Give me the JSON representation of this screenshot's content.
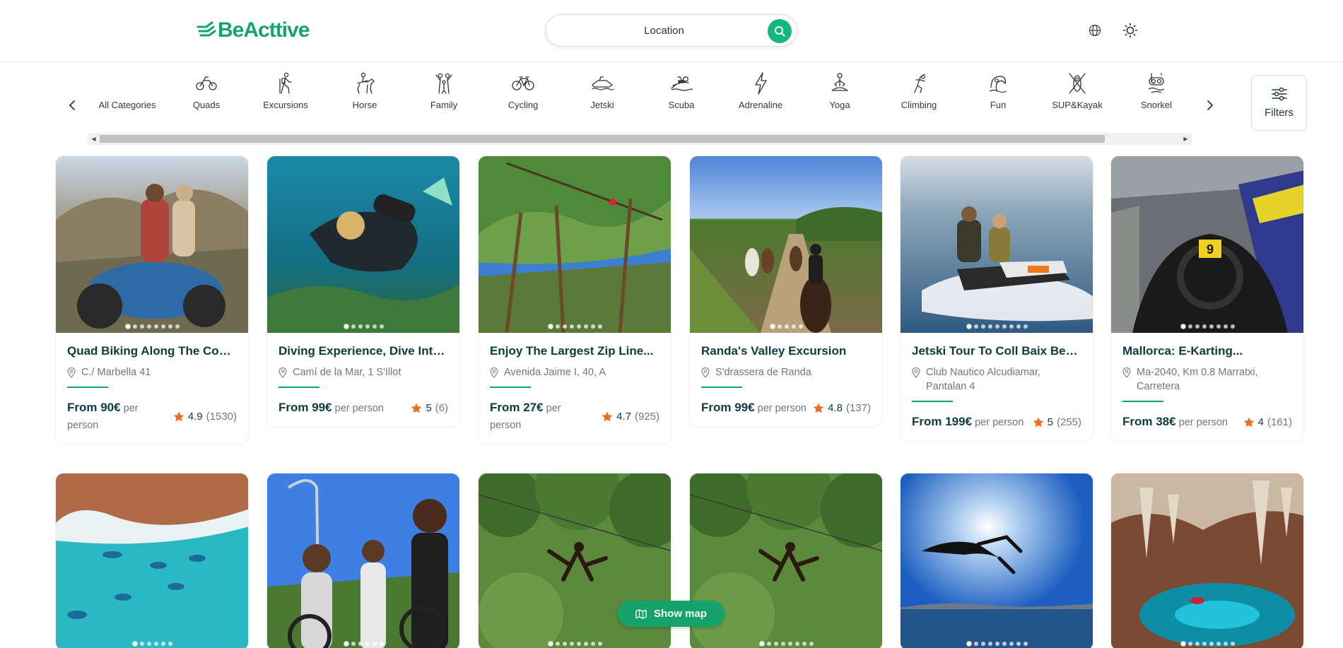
{
  "header": {
    "logo": "BeActtive",
    "search_label": "Location"
  },
  "categories": {
    "items": [
      {
        "label": "All Categories",
        "icon": "all-categories-icon"
      },
      {
        "label": "Quads",
        "icon": "quad-icon"
      },
      {
        "label": "Excursions",
        "icon": "hiker-icon"
      },
      {
        "label": "Horse",
        "icon": "horse-icon"
      },
      {
        "label": "Family",
        "icon": "family-icon"
      },
      {
        "label": "Cycling",
        "icon": "bicycle-icon"
      },
      {
        "label": "Jetski",
        "icon": "jetski-icon"
      },
      {
        "label": "Scuba",
        "icon": "scuba-icon"
      },
      {
        "label": "Adrenaline",
        "icon": "lightning-icon"
      },
      {
        "label": "Yoga",
        "icon": "yoga-icon"
      },
      {
        "label": "Climbing",
        "icon": "climbing-icon"
      },
      {
        "label": "Fun",
        "icon": "fun-icon"
      },
      {
        "label": "SUP&Kayak",
        "icon": "kayak-icon"
      },
      {
        "label": "Snorkel",
        "icon": "snorkel-icon"
      }
    ],
    "filters_label": "Filters"
  },
  "cards": [
    {
      "title": "Quad Biking Along The Coas...",
      "location": "C./ Marbella 41",
      "price": "From 90€",
      "per": "per person",
      "rating": "4.9",
      "count": "(1530)",
      "dots": 8,
      "active_dot": 1
    },
    {
      "title": "Diving Experience, Dive Into...",
      "location": "Camí de la Mar, 1 S'Illot",
      "price": "From 99€",
      "per": "per person",
      "rating": "5",
      "count": "(6)",
      "dots": 6,
      "active_dot": 1
    },
    {
      "title": "Enjoy The Largest Zip Line...",
      "location": "Avenida Jaime I, 40, A",
      "price": "From 27€",
      "per": "per person",
      "rating": "4.7",
      "count": "(925)",
      "dots": 8,
      "active_dot": 1
    },
    {
      "title": "Randa's Valley Excursion",
      "location": "S'drassera de Randa",
      "price": "From 99€",
      "per": "per person",
      "rating": "4.8",
      "count": "(137)",
      "dots": 5,
      "active_dot": 1
    },
    {
      "title": "Jetski Tour To Coll Baix Beach",
      "location": "Club Nautico Alcudiamar, Pantalan 4",
      "price": "From 199€",
      "per": "per person",
      "rating": "5",
      "count": "(255)",
      "dots": 9,
      "active_dot": 1
    },
    {
      "title": "Mallorca: E-Karting...",
      "location": "Ma-2040, Km 0.8 Marratxi, Carretera",
      "price": "From 38€",
      "per": "per person",
      "rating": "4",
      "count": "(161)",
      "dots": 8,
      "active_dot": 1
    },
    {
      "dots": 6,
      "active_dot": 1
    },
    {
      "dots": 6,
      "active_dot": 1
    },
    {
      "dots": 8,
      "active_dot": 1
    },
    {
      "dots": 8,
      "active_dot": 1
    },
    {
      "dots": 9,
      "active_dot": 1
    },
    {
      "dots": 8,
      "active_dot": 1
    }
  ],
  "map_button": "Show map",
  "colors": {
    "brand": "#14a36b",
    "star": "#f26a1b",
    "search_button": "#14b87a"
  }
}
